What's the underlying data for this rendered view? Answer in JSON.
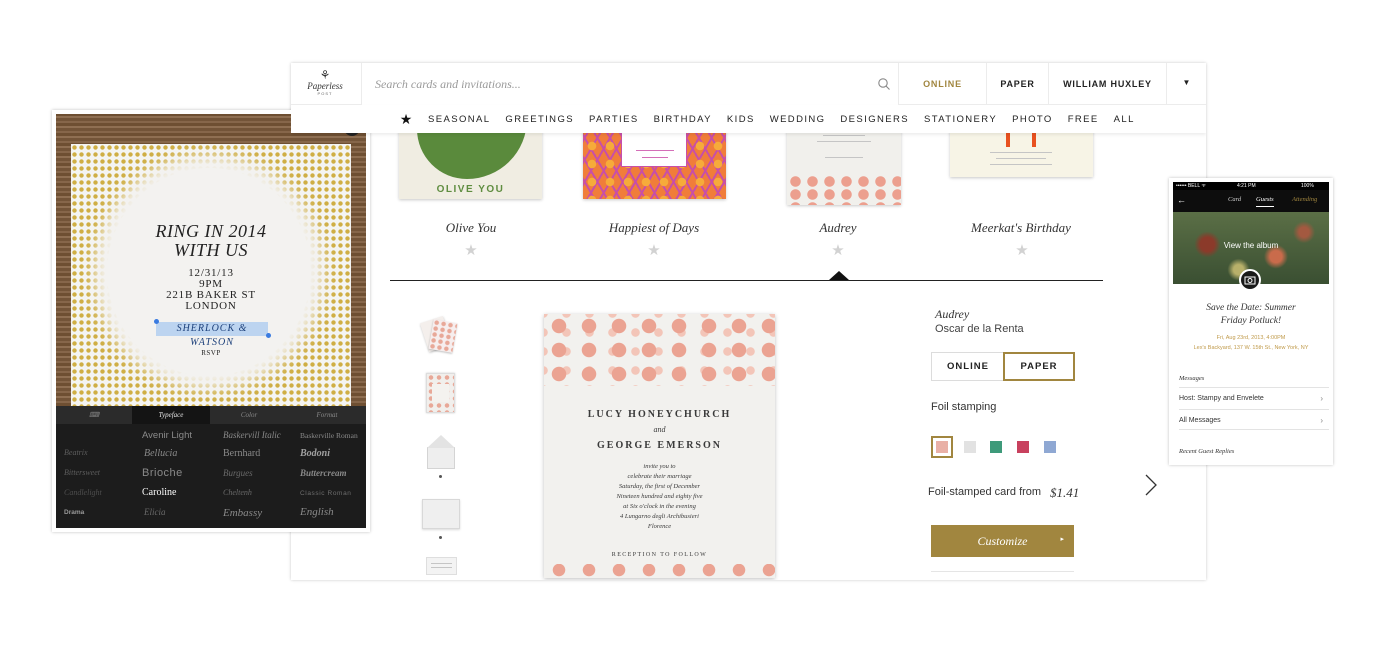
{
  "colors": {
    "accent": "#a1863f",
    "nav_text": "#222222",
    "star_inactive": "#d2d2d2",
    "dark_panel": "#1c1c1c"
  },
  "header": {
    "logo_text": "Paperless",
    "logo_subtext": "POST",
    "search_placeholder": "Search cards and invitations...",
    "online_label": "ONLINE",
    "paper_label": "PAPER",
    "user_label": "WILLIAM HUXLEY",
    "caret_icon": "caret-down-icon"
  },
  "categories": [
    "SEASONAL",
    "GREETINGS",
    "PARTIES",
    "BIRTHDAY",
    "KIDS",
    "WEDDING",
    "DESIGNERS",
    "STATIONERY",
    "PHOTO",
    "FREE",
    "ALL"
  ],
  "card_row": {
    "thumb_texts": {
      "olive": "OLIVE YOU"
    },
    "cards": [
      {
        "name": "Olive You"
      },
      {
        "name": "Happiest of Days"
      },
      {
        "name": "Audrey"
      },
      {
        "name": "Meerkat's Birthday"
      }
    ]
  },
  "detail": {
    "card_lines": {
      "name1": "LUCY HONEYCHURCH",
      "and": "and",
      "name2": "GEORGE EMERSON",
      "body": [
        "invite you to",
        "celebrate their marriage",
        "Saturday, the first of December",
        "Nineteen hundred and eighty five",
        "at Six o'clock in the evening",
        "4 Lungarno degli Archibusieri",
        "Florence"
      ],
      "reception": "RECEPTION TO FOLLOW"
    },
    "title": "Audrey",
    "designer": "Oscar de la Renta",
    "format_online": "ONLINE",
    "format_paper": "PAPER",
    "foil_label": "Foil stamping",
    "price_label": "Foil-stamped card from",
    "price_value": "$1.41",
    "customize_label": "Customize",
    "customize_caret": "▸",
    "swatch_colors": [
      "#e9b0a6",
      "#e2e2e2",
      "#3e9a7a",
      "#c8415e",
      "#8fa8d3"
    ]
  },
  "tablet": {
    "headline1": "RING IN 2014",
    "headline2": "WITH US",
    "date": "12/31/13",
    "time": "9PM",
    "address1": "221B BAKER ST",
    "address2": "LONDON",
    "selected_text": "SHERLOCK & WATSON",
    "rsvp": "RSVP",
    "tabs": [
      "",
      "Typeface",
      "Color",
      "Format"
    ],
    "fonts": [
      [
        "",
        "Avenir Light",
        "Baskervill Italic",
        "Baskerville Roman"
      ],
      [
        "Beatrix",
        "Bellucia",
        "Bernhard",
        "Bodoni"
      ],
      [
        "Bittersweet",
        "Brioche",
        "Burgues",
        "Buttercream"
      ],
      [
        "Candlelight",
        "Caroline",
        "Cheltenh",
        "Classic Roman"
      ],
      [
        "Drama",
        "Elicia",
        "Embassy",
        "English"
      ]
    ]
  },
  "phone": {
    "carrier": "•••••• BELL ᯤ",
    "time": "4:21 PM",
    "battery": "100%",
    "tabs": [
      "Card",
      "Guests",
      "Attending"
    ],
    "album_label": "View the album",
    "event_title1": "Save the Date: Summer",
    "event_title2": "Friday Potluck!",
    "event_date": "Fri, Aug 23rd, 2013, 4:00PM",
    "event_location": "Lex's Backyard, 137 W. 15th St., New York, NY",
    "messages_header": "Messages",
    "messages": [
      "Host: Stampy and Envelete",
      "All Messages"
    ],
    "replies_header": "Recent Guest Replies"
  }
}
